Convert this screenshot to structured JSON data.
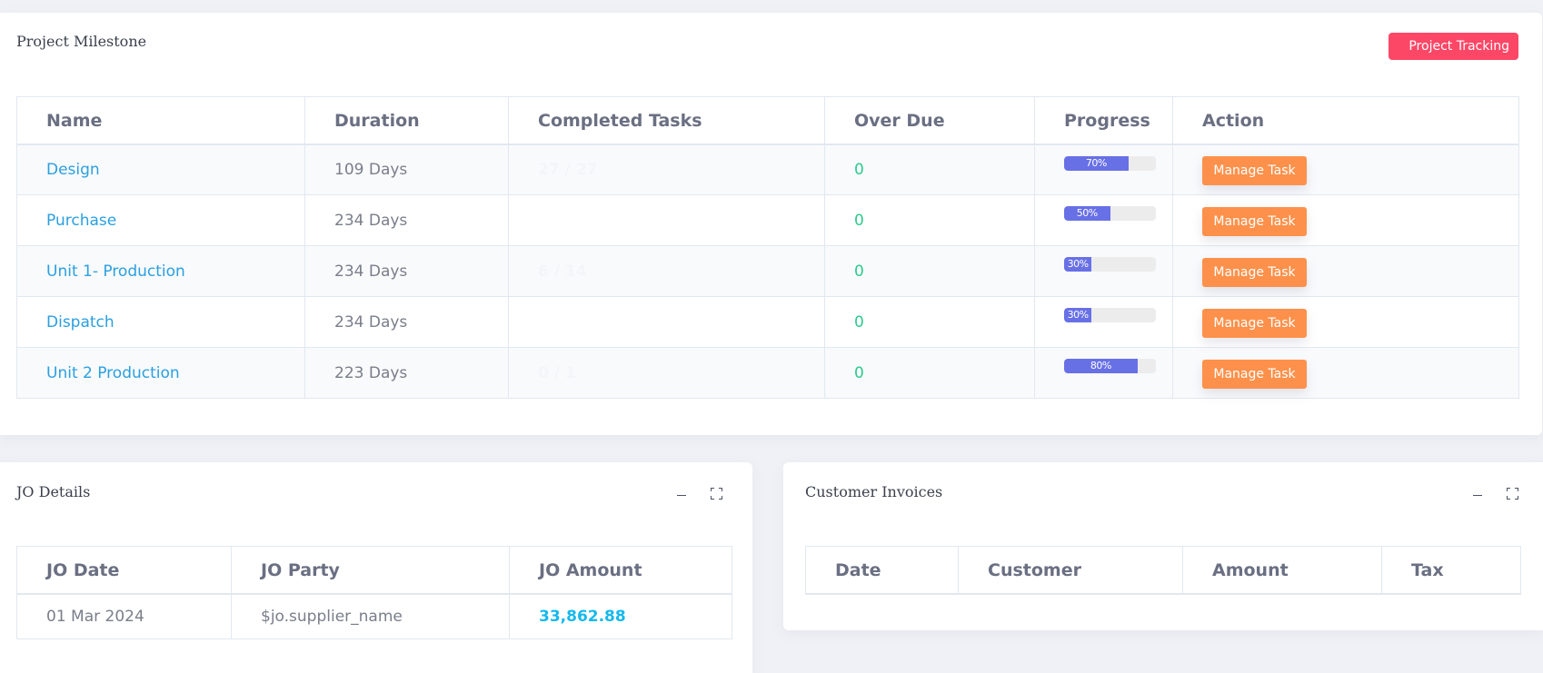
{
  "milestone": {
    "title": "Project Milestone",
    "tracking_button": "Project Tracking",
    "columns": [
      "Name",
      "Duration",
      "Completed Tasks",
      "Over Due",
      "Progress",
      "Action"
    ],
    "rows": [
      {
        "name": "Design",
        "duration": "109 Days",
        "completed": "27 / 27",
        "overdue": "0",
        "progress": 70,
        "progress_label": "70%",
        "action": "Manage Task"
      },
      {
        "name": "Purchase",
        "duration": "234 Days",
        "completed": "",
        "overdue": "0",
        "progress": 50,
        "progress_label": "50%",
        "action": "Manage Task"
      },
      {
        "name": "Unit 1- Production",
        "duration": "234 Days",
        "completed": "6 / 14",
        "overdue": "0",
        "progress": 30,
        "progress_label": "30%",
        "action": "Manage Task"
      },
      {
        "name": "Dispatch",
        "duration": "234 Days",
        "completed": "",
        "overdue": "0",
        "progress": 30,
        "progress_label": "30%",
        "action": "Manage Task"
      },
      {
        "name": "Unit 2 Production",
        "duration": "223 Days",
        "completed": "0 / 1",
        "overdue": "0",
        "progress": 80,
        "progress_label": "80%",
        "action": "Manage Task"
      }
    ]
  },
  "jo_details": {
    "title": "JO Details",
    "columns": [
      "JO Date",
      "JO Party",
      "JO Amount"
    ],
    "rows": [
      {
        "date": "01 Mar 2024",
        "party": "$jo.supplier_name",
        "amount": "33,862.88"
      }
    ]
  },
  "customer_invoices": {
    "title": "Customer Invoices",
    "columns": [
      "Date",
      "Customer",
      "Amount",
      "Tax"
    ],
    "rows": []
  },
  "icons": {
    "minimize": "minus-icon",
    "expand": "expand-icon"
  },
  "colors": {
    "tracking_button": "#fd4766",
    "manage_button": "#fd914b",
    "progress_fill": "#6870e6",
    "link": "#2b9fe0",
    "overdue": "#2dca8c",
    "amount": "#15b9ec"
  }
}
